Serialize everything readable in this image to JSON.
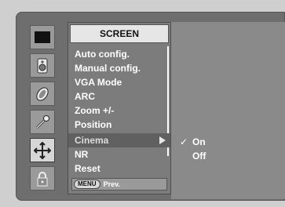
{
  "screen_menu": {
    "title": "SCREEN",
    "items": [
      "Auto config.",
      "Manual config.",
      "VGA Mode",
      "ARC",
      "Zoom +/-",
      "Position",
      "Cinema",
      "NR",
      "Reset"
    ],
    "selected_item": "Cinema",
    "footer": {
      "key": "MENU",
      "label": "Prev."
    }
  },
  "submenu": {
    "options": [
      "On",
      "Off"
    ],
    "checked": "On",
    "check_glyph": "✓"
  },
  "sidebar_icons": [
    "picture-icon",
    "sound-icon",
    "time-icon",
    "special-icon",
    "screen-icon",
    "lock-icon"
  ],
  "active_sidebar_icon": "screen-icon",
  "colors": {
    "background": "#cfcfcf",
    "osd_panel": "#6e6e6e",
    "menu": "#7c7c7c",
    "title_bar": "#e6e6e6",
    "text": "#ffffff"
  }
}
